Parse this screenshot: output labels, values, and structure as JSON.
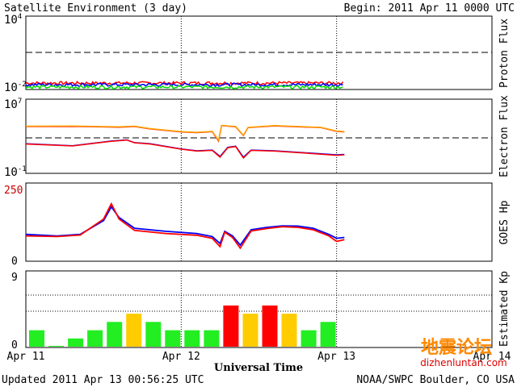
{
  "header": {
    "title": "Satellite Environment (3 day)",
    "begin": "Begin:  2011 Apr 11 0000 UTC"
  },
  "footer": {
    "updated": "Updated 2011 Apr 13 00:56:25 UTC",
    "credit": "NOAA/SWPC Boulder, CO USA",
    "xlabel": "Universal Time",
    "watermark": "地震论坛",
    "watermark_url": "dizhenluntan.com"
  },
  "colors": {
    "red": "#ff0000",
    "blue": "#0000ff",
    "green": "#00dd00",
    "orange": "#ffa500",
    "kp_green": "#22ee22",
    "kp_yellow": "#ffcc00",
    "kp_red": "#ff0000"
  },
  "chart_data": [
    {
      "type": "line",
      "ylabel": "Proton Flux",
      "scale": "log",
      "ylim": [
        0.01,
        10000
      ],
      "ytick_labels": [
        {
          "base": "10",
          "exp": "4"
        },
        {
          "base": "10",
          "exp": "-2"
        }
      ],
      "threshold": 10,
      "series": [
        {
          "color": "red",
          "level": 0.03
        },
        {
          "color": "blue",
          "level": 0.022
        },
        {
          "color": "green",
          "level": 0.014
        }
      ]
    },
    {
      "type": "line",
      "ylabel": "Electron Flux",
      "scale": "log",
      "ylim": [
        0.1,
        10000000
      ],
      "ytick_labels": [
        {
          "base": "10",
          "exp": "7"
        },
        {
          "base": "10",
          "exp": "-1"
        }
      ],
      "threshold": 1000,
      "series": [
        {
          "color": "red",
          "points": [
            [
              0,
              12000
            ],
            [
              0.3,
              12500
            ],
            [
              0.6,
              10000
            ],
            [
              0.7,
              12000
            ],
            [
              0.8,
              6500
            ],
            [
              1.0,
              3000
            ],
            [
              1.1,
              2500
            ],
            [
              1.2,
              3200
            ],
            [
              1.24,
              300
            ],
            [
              1.26,
              15000
            ],
            [
              1.35,
              11000
            ],
            [
              1.4,
              1200
            ],
            [
              1.43,
              9000
            ],
            [
              1.6,
              14000
            ],
            [
              1.9,
              9000
            ],
            [
              2.0,
              3500
            ],
            [
              2.05,
              3000
            ]
          ]
        },
        {
          "color": "orange",
          "points": [
            [
              0,
              13000
            ],
            [
              0.3,
              13500
            ],
            [
              0.6,
              11000
            ],
            [
              0.7,
              13000
            ],
            [
              0.8,
              7000
            ],
            [
              1.0,
              3300
            ],
            [
              1.1,
              2700
            ],
            [
              1.2,
              3500
            ],
            [
              1.24,
              350
            ],
            [
              1.26,
              16000
            ],
            [
              1.35,
              12000
            ],
            [
              1.4,
              1300
            ],
            [
              1.43,
              9500
            ],
            [
              1.6,
              15000
            ],
            [
              1.9,
              9500
            ],
            [
              2.0,
              3800
            ],
            [
              2.05,
              3300
            ]
          ]
        },
        {
          "color": "blue",
          "points": [
            [
              0,
              150
            ],
            [
              0.3,
              90
            ],
            [
              0.55,
              300
            ],
            [
              0.65,
              400
            ],
            [
              0.7,
              200
            ],
            [
              0.8,
              150
            ],
            [
              1.0,
              40
            ],
            [
              1.1,
              25
            ],
            [
              1.2,
              30
            ],
            [
              1.25,
              6
            ],
            [
              1.3,
              60
            ],
            [
              1.35,
              80
            ],
            [
              1.4,
              5
            ],
            [
              1.45,
              30
            ],
            [
              1.6,
              25
            ],
            [
              1.8,
              15
            ],
            [
              2.0,
              9
            ],
            [
              2.05,
              10
            ]
          ]
        },
        {
          "color": "red",
          "points": [
            [
              0,
              140
            ],
            [
              0.3,
              85
            ],
            [
              0.55,
              280
            ],
            [
              0.65,
              380
            ],
            [
              0.7,
              190
            ],
            [
              0.8,
              140
            ],
            [
              1.0,
              38
            ],
            [
              1.1,
              23
            ],
            [
              1.2,
              28
            ],
            [
              1.25,
              5
            ],
            [
              1.3,
              55
            ],
            [
              1.35,
              75
            ],
            [
              1.4,
              4
            ],
            [
              1.45,
              28
            ],
            [
              1.6,
              23
            ],
            [
              1.8,
              14
            ],
            [
              2.0,
              8
            ],
            [
              2.05,
              9
            ]
          ]
        }
      ]
    },
    {
      "type": "line",
      "ylabel": "GOES Hp",
      "ylim": [
        0,
        250
      ],
      "ytick_labels": [
        "250",
        "0"
      ],
      "series": [
        {
          "color": "blue",
          "points": [
            [
              0,
              85
            ],
            [
              0.2,
              80
            ],
            [
              0.35,
              85
            ],
            [
              0.5,
              130
            ],
            [
              0.55,
              175
            ],
            [
              0.6,
              140
            ],
            [
              0.7,
              105
            ],
            [
              0.9,
              95
            ],
            [
              1.1,
              88
            ],
            [
              1.2,
              78
            ],
            [
              1.25,
              55
            ],
            [
              1.28,
              95
            ],
            [
              1.33,
              80
            ],
            [
              1.38,
              50
            ],
            [
              1.45,
              100
            ],
            [
              1.55,
              108
            ],
            [
              1.65,
              113
            ],
            [
              1.75,
              112
            ],
            [
              1.85,
              105
            ],
            [
              1.95,
              85
            ],
            [
              2.0,
              72
            ],
            [
              2.05,
              75
            ]
          ]
        },
        {
          "color": "red",
          "points": [
            [
              0,
              80
            ],
            [
              0.2,
              78
            ],
            [
              0.35,
              83
            ],
            [
              0.5,
              135
            ],
            [
              0.55,
              185
            ],
            [
              0.6,
              135
            ],
            [
              0.7,
              98
            ],
            [
              0.9,
              88
            ],
            [
              1.1,
              82
            ],
            [
              1.2,
              72
            ],
            [
              1.25,
              45
            ],
            [
              1.28,
              92
            ],
            [
              1.33,
              75
            ],
            [
              1.38,
              40
            ],
            [
              1.45,
              96
            ],
            [
              1.55,
              104
            ],
            [
              1.65,
              110
            ],
            [
              1.75,
              108
            ],
            [
              1.85,
              100
            ],
            [
              1.95,
              80
            ],
            [
              2.0,
              62
            ],
            [
              2.05,
              68
            ]
          ]
        }
      ]
    },
    {
      "type": "bar",
      "ylabel": "Estimated Kp",
      "ylim": [
        0,
        9
      ],
      "ytick_labels": [
        "9",
        "0"
      ],
      "values": [
        2,
        0.1,
        1,
        2,
        3,
        4,
        3,
        2,
        2,
        2,
        5,
        4,
        5,
        4,
        2,
        3
      ],
      "bar_colors": [
        "kp_green",
        "kp_green",
        "kp_green",
        "kp_green",
        "kp_green",
        "kp_yellow",
        "kp_green",
        "kp_green",
        "kp_green",
        "kp_green",
        "kp_red",
        "kp_yellow",
        "kp_red",
        "kp_yellow",
        "kp_green",
        "kp_green"
      ]
    },
    {
      "type": "axis",
      "x_tick_labels": [
        "Apr 11",
        "Apr 12",
        "Apr 13",
        "Apr 14"
      ],
      "xlim_days": [
        0,
        3
      ]
    }
  ]
}
